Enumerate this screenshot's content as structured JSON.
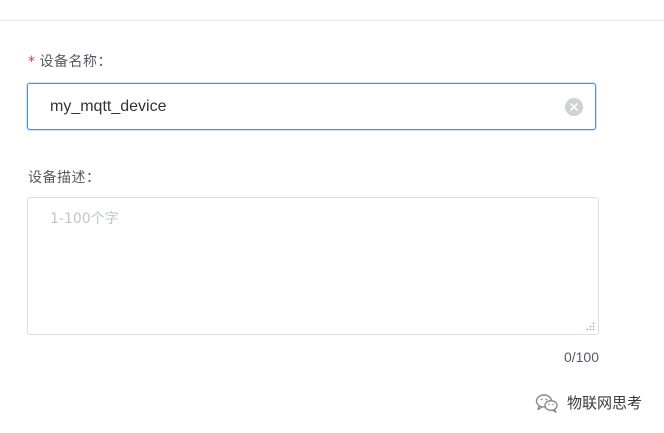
{
  "form": {
    "device_name": {
      "required_mark": "*",
      "label": "设备名称：",
      "value": "my_mqtt_device"
    },
    "device_description": {
      "label": "设备描述：",
      "placeholder": "1-100个字",
      "value": "",
      "counter": "0/100"
    }
  },
  "watermark": {
    "text": "物联网思考",
    "icon": "wechat-icon"
  },
  "colors": {
    "focus_border": "#4a8ef0",
    "required": "#e23b3b",
    "placeholder": "#c0c4cc"
  }
}
